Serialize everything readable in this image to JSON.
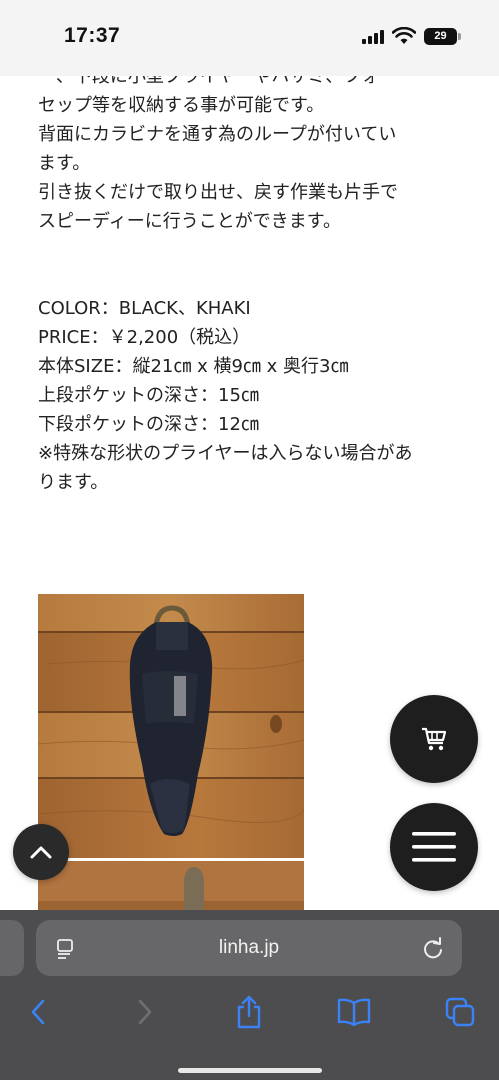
{
  "status_bar": {
    "time": "17:37",
    "battery_level": "29",
    "icons": [
      "signal-icon",
      "wifi-icon",
      "battery-icon"
    ]
  },
  "article": {
    "description_lines": [
      "ー、下段に小型プライヤーやハサミ、フォー",
      "セップ等を収納する事が可能です。",
      "背面にカラビナを通す為のループが付いてい",
      "ます。",
      "引き抜くだけで取り出せ、戻す作業も片手で",
      "スピーディーに行うことができます。"
    ],
    "spec_lines": [
      "COLOR：BLACK、KHAKI",
      "PRICE：￥2,200（税込）",
      "本体SIZE：縦21㎝ x 横9㎝ x 奥行3㎝",
      "上段ポケットの深さ：15㎝",
      "下段ポケットの深さ：12㎝",
      "※特殊な形状のプライヤーは入らない場合があ",
      "ります。"
    ]
  },
  "floating_buttons": {
    "cart_icon": "cart-icon",
    "menu_icon": "hamburger-icon",
    "top_icon": "chevron-up-icon"
  },
  "browser": {
    "url": "linha.jp",
    "toolbar_icons": [
      "back-icon",
      "forward-icon",
      "share-icon",
      "bookmarks-icon",
      "tabs-icon"
    ]
  },
  "colors": {
    "fab_background": "#1e1e1e",
    "browser_bar": "#4d4d4f",
    "url_field": "#676769",
    "toolbar_icon": "#3b82f6",
    "wood": "#a8703a"
  }
}
